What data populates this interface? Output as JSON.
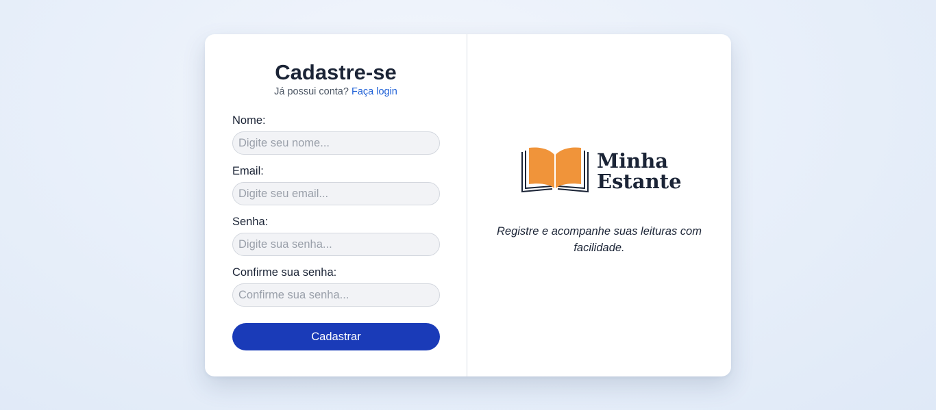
{
  "form": {
    "title": "Cadastre-se",
    "login_prompt": "Já possui conta?",
    "login_link": "Faça login",
    "fields": [
      {
        "label": "Nome:",
        "placeholder": "Digite seu nome...",
        "value": ""
      },
      {
        "label": "Email:",
        "placeholder": "Digite seu email...",
        "value": ""
      },
      {
        "label": "Senha:",
        "placeholder": "Digite sua senha...",
        "value": ""
      },
      {
        "label": "Confirme sua senha:",
        "placeholder": "Confirme sua senha...",
        "value": ""
      }
    ],
    "submit_label": "Cadastrar"
  },
  "brand": {
    "logo_icon": "open-book-icon",
    "name_line1": "Minha",
    "name_line2": "Estante",
    "tagline": "Registre e acompanhe suas leituras com facilidade."
  },
  "colors": {
    "primary_button": "#1a3bb8",
    "link": "#1d5fd6",
    "logo_book": "#f0943a",
    "logo_text": "#1b2436"
  }
}
